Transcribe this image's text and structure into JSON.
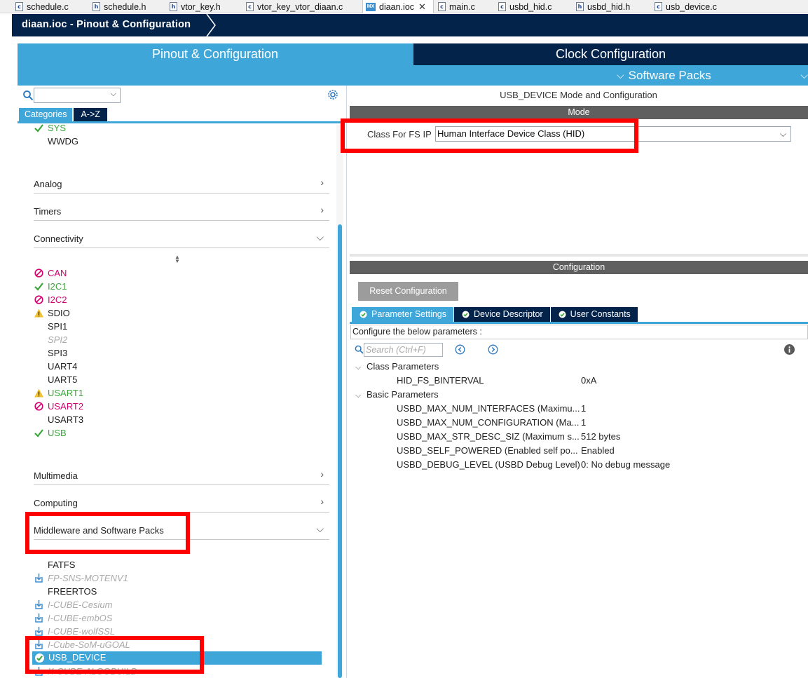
{
  "colors": {
    "accent_blue": "#3ea6d9",
    "navy": "#03234b",
    "gray_bar": "#5f5f5f",
    "status_green": "#3aa53a",
    "status_magenta": "#d4006f",
    "warning_yellow": "#f1c232",
    "annotation_red": "#ff0000"
  },
  "editor_tabs": [
    {
      "label": "schedule.c",
      "icon": "c-file-icon"
    },
    {
      "label": "schedule.h",
      "icon": "h-file-icon"
    },
    {
      "label": "vtor_key.h",
      "icon": "h-file-icon"
    },
    {
      "label": "vtor_key_vtor_diaan.c",
      "icon": "c-file-icon"
    },
    {
      "label": "diaan.ioc",
      "icon": "mx-file-icon",
      "active": true,
      "close": "✕"
    },
    {
      "label": "main.c",
      "icon": "c-file-icon"
    },
    {
      "label": "usbd_hid.c",
      "icon": "c-file-icon"
    },
    {
      "label": "usbd_hid.h",
      "icon": "h-file-icon"
    },
    {
      "label": "usb_device.c",
      "icon": "c-file-icon"
    }
  ],
  "breadcrumb": {
    "title": "diaan.ioc - Pinout & Configuration"
  },
  "main_tabs": {
    "pinout": "Pinout & Configuration",
    "clock": "Clock Configuration",
    "software_packs": "Software Packs"
  },
  "left_panel": {
    "tabs": {
      "categories": "Categories",
      "az": "A->Z"
    },
    "system_items": [
      {
        "label": "SYS",
        "status": "ok"
      },
      {
        "label": "WWDG",
        "status": "none"
      }
    ],
    "categories": {
      "analog": "Analog",
      "timers": "Timers",
      "connectivity": "Connectivity",
      "multimedia": "Multimedia",
      "computing": "Computing",
      "middleware": "Middleware and Software Packs"
    },
    "connectivity_items": [
      {
        "label": "CAN",
        "status": "disabled-conflict"
      },
      {
        "label": "I2C1",
        "status": "ok"
      },
      {
        "label": "I2C2",
        "status": "disabled-conflict"
      },
      {
        "label": "SDIO",
        "status": "warning"
      },
      {
        "label": "SPI1",
        "status": "none"
      },
      {
        "label": "SPI2",
        "status": "unavailable"
      },
      {
        "label": "SPI3",
        "status": "none"
      },
      {
        "label": "UART4",
        "status": "none"
      },
      {
        "label": "UART5",
        "status": "none"
      },
      {
        "label": "USART1",
        "status": "warning"
      },
      {
        "label": "USART2",
        "status": "disabled-conflict"
      },
      {
        "label": "USART3",
        "status": "none"
      },
      {
        "label": "USB",
        "status": "ok"
      }
    ],
    "middleware_items": [
      {
        "label": "FATFS",
        "status": "none"
      },
      {
        "label": "FP-SNS-MOTENV1",
        "status": "pack"
      },
      {
        "label": "FREERTOS",
        "status": "none"
      },
      {
        "label": "I-CUBE-Cesium",
        "status": "pack"
      },
      {
        "label": "I-CUBE-embOS",
        "status": "pack"
      },
      {
        "label": "I-CUBE-wolfSSL",
        "status": "pack"
      },
      {
        "label": "I-Cube-SoM-uGOAL",
        "status": "pack"
      },
      {
        "label": "USB_DEVICE",
        "status": "selected"
      },
      {
        "label": "X-CUBE-ALGOBUILD",
        "status": "pack"
      }
    ]
  },
  "right_panel": {
    "mode_title": "USB_DEVICE Mode and Configuration",
    "mode_header": "Mode",
    "class_label": "Class For FS IP",
    "class_value": "Human Interface Device Class (HID)",
    "config_header": "Configuration",
    "reset_button": "Reset Configuration",
    "config_tabs": [
      "Parameter Settings",
      "Device Descriptor",
      "User Constants"
    ],
    "config_hint": "Configure the below parameters :",
    "search_placeholder": "Search (Ctrl+F)",
    "groups": [
      {
        "name": "Class Parameters",
        "params": [
          {
            "name": "HID_FS_BINTERVAL",
            "value": "0xA"
          }
        ]
      },
      {
        "name": "Basic Parameters",
        "params": [
          {
            "name": "USBD_MAX_NUM_INTERFACES (Maximu...",
            "value": "1"
          },
          {
            "name": "USBD_MAX_NUM_CONFIGURATION (Ma...",
            "value": "1"
          },
          {
            "name": "USBD_MAX_STR_DESC_SIZ (Maximum s...",
            "value": "512 bytes"
          },
          {
            "name": "USBD_SELF_POWERED (Enabled self po...",
            "value": "Enabled"
          },
          {
            "name": "USBD_DEBUG_LEVEL (USBD Debug Level)",
            "value": "0: No debug message"
          }
        ]
      }
    ]
  }
}
